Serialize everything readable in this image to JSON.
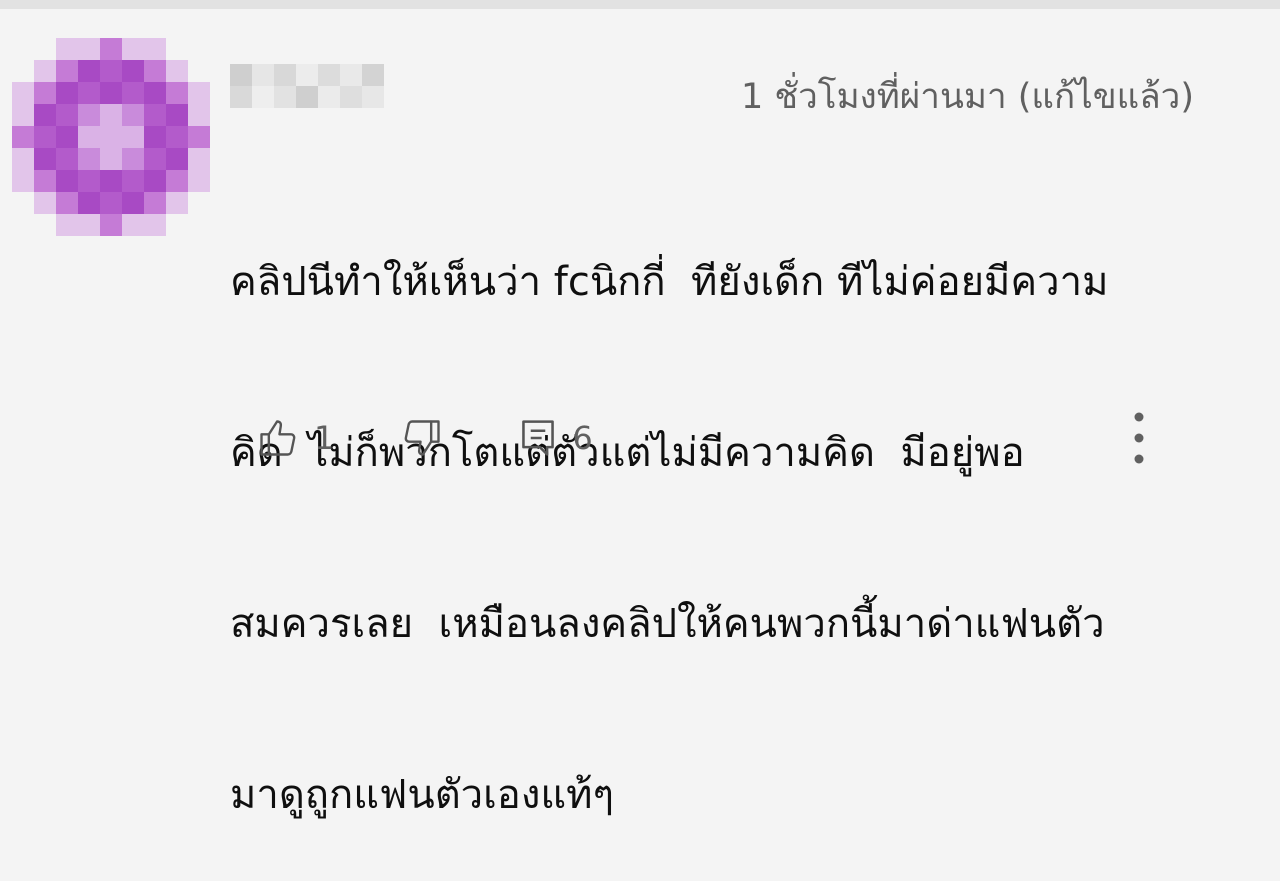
{
  "comment": {
    "timestamp": "1 ชั่วโมงที่ผ่านมา (แก้ไขแล้ว)",
    "text": "คลิปนีทำให้เห็นว่า fcนิกกี่  ทียังเด็ก ทีไม่ค่อยมีความคิด  ไม่ก็พวกโตแต่ตัวแต่ไม่มีความคิด  มีอยู่พอสมควรเลย  เหมือนลงคลิปให้คนพวกนี้มาด่าแฟนตัวมาดูถูกแฟนตัวเองแท้ๆ",
    "text_lines": [
      "คลิปนีทำให้เห็นว่า fcนิกกี่  ทียังเด็ก ทีไม่ค่อยมีความ",
      "คิด  ไม่ก็พวกโตแต่ตัวแต่ไม่มีความคิด  มีอยู่พอ",
      "สมควรเลย  เหมือนลงคลิปให้คนพวกนี้มาด่าแฟนตัว",
      "มาดูถูกแฟนตัวเองแท้ๆ"
    ],
    "like_count": "1",
    "reply_count": "6"
  },
  "icons": {
    "like": "thumbs-up-icon",
    "dislike": "thumbs-down-icon",
    "reply": "comment-icon",
    "more": "more-vertical-icon"
  },
  "colors": {
    "background": "#f4f4f4",
    "text_primary": "#0f0f0f",
    "text_secondary": "#606060",
    "avatar_accent": "#a84ac4"
  }
}
